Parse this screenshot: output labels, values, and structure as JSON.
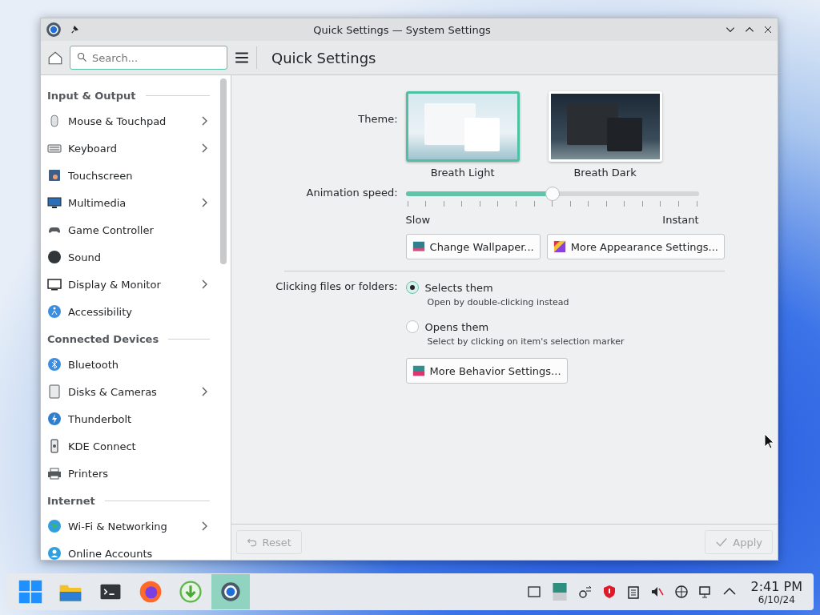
{
  "window": {
    "title": "Quick Settings — System Settings"
  },
  "header": {
    "search_placeholder": "Search...",
    "page_title": "Quick Settings"
  },
  "sidebar": {
    "sections": [
      {
        "heading": "Input & Output",
        "items": [
          {
            "label": "Mouse & Touchpad",
            "expandable": true
          },
          {
            "label": "Keyboard",
            "expandable": true
          },
          {
            "label": "Touchscreen",
            "expandable": false
          },
          {
            "label": "Multimedia",
            "expandable": true
          },
          {
            "label": "Game Controller",
            "expandable": false
          },
          {
            "label": "Sound",
            "expandable": false
          },
          {
            "label": "Display & Monitor",
            "expandable": true
          },
          {
            "label": "Accessibility",
            "expandable": false
          }
        ]
      },
      {
        "heading": "Connected Devices",
        "items": [
          {
            "label": "Bluetooth",
            "expandable": false
          },
          {
            "label": "Disks & Cameras",
            "expandable": true
          },
          {
            "label": "Thunderbolt",
            "expandable": false
          },
          {
            "label": "KDE Connect",
            "expandable": false
          },
          {
            "label": "Printers",
            "expandable": false
          }
        ]
      },
      {
        "heading": "Internet",
        "items": [
          {
            "label": "Wi-Fi & Networking",
            "expandable": true
          },
          {
            "label": "Online Accounts",
            "expandable": false
          }
        ]
      }
    ]
  },
  "theme": {
    "label": "Theme:",
    "options": [
      {
        "name": "Breath Light",
        "kind": "light",
        "selected": true
      },
      {
        "name": "Breath Dark",
        "kind": "dark",
        "selected": false
      }
    ]
  },
  "animation": {
    "label": "Animation speed:",
    "level": 0.5,
    "min_label": "Slow",
    "max_label": "Instant"
  },
  "appearance_buttons": [
    "Change Wallpaper...",
    "More Appearance Settings..."
  ],
  "clicking": {
    "label": "Clicking files or folders:",
    "options": [
      {
        "label": "Selects them",
        "description": "Open by double-clicking instead",
        "selected": true
      },
      {
        "label": "Opens them",
        "description": "Select by clicking on item's selection marker",
        "selected": false
      }
    ]
  },
  "behavior_button": "More Behavior Settings...",
  "footer": {
    "reset": {
      "label": "Reset",
      "disabled": true
    },
    "apply": {
      "label": "Apply",
      "disabled": true
    }
  },
  "taskbar": {
    "apps": [
      {
        "kind": "start",
        "active": false
      },
      {
        "kind": "files",
        "active": false
      },
      {
        "kind": "terminal",
        "active": false
      },
      {
        "kind": "browser",
        "active": false
      },
      {
        "kind": "download",
        "active": false
      },
      {
        "kind": "settings",
        "active": true
      }
    ],
    "time": "2:41 PM",
    "date": "6/10/24"
  }
}
